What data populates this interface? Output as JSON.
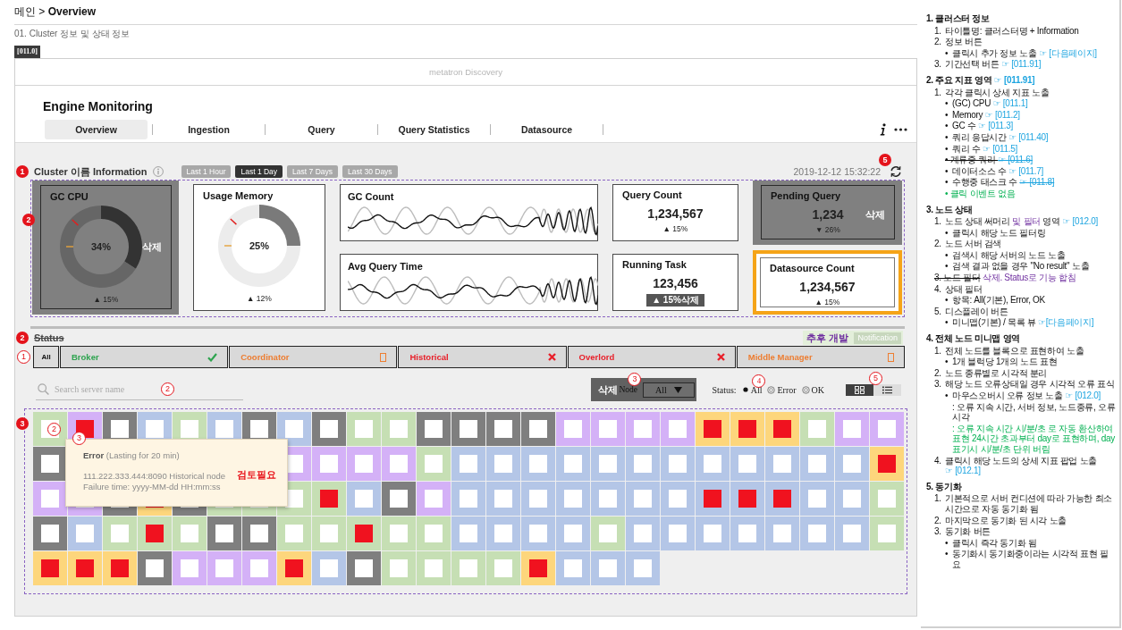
{
  "breadcrumb": "메인 > **Overview**",
  "subtitle": "01. Cluster 정보 및 상태 정보",
  "screen_tag": "[011.0]",
  "app_bar": {
    "title": "metatron Discovery"
  },
  "header": {
    "title": "Engine Monitoring",
    "tabs": [
      {
        "label": "Overview",
        "selected": true
      },
      {
        "label": "Ingestion",
        "selected": false
      },
      {
        "label": "Query",
        "selected": false
      },
      {
        "label": "Query Statistics",
        "selected": false
      },
      {
        "label": "Datasource",
        "selected": false
      }
    ]
  },
  "cluster": {
    "badge": "1",
    "title": "Cluster 이름 Information",
    "ranges": [
      {
        "label": "Last 1 Hour",
        "selected": false
      },
      {
        "label": "Last 1 Day",
        "selected": true
      },
      {
        "label": "Last 7 Days",
        "selected": false
      },
      {
        "label": "Last 30 Days",
        "selected": false
      }
    ],
    "synced_at": "2019-12-12 15:32:22",
    "sync_badge": "5"
  },
  "metrics": {
    "badge": "2",
    "cards": [
      {
        "kind": "donut",
        "title": "GC CPU",
        "value": "34%",
        "chart_data": {
          "type": "donut",
          "values": [
            34,
            66
          ]
        },
        "change": "▲ 15%",
        "note": "삭제",
        "removed": true,
        "highlighted": false
      },
      {
        "kind": "donut",
        "title": "Usage Memory",
        "value": "25%",
        "chart_data": {
          "type": "donut",
          "values": [
            25,
            75
          ]
        },
        "change": "▲ 12%",
        "removed": false,
        "highlighted": false
      },
      {
        "kind": "trend",
        "title": "GC Count",
        "removed": false,
        "highlighted": false
      },
      {
        "kind": "stat",
        "title": "Query Count",
        "value": "1,234,567",
        "change": "▲ 15%",
        "removed": false,
        "highlighted": false
      },
      {
        "kind": "stat",
        "title": "Pending Query",
        "value": "1,234",
        "change": "▼ 26%",
        "note": "삭제",
        "removed": true,
        "highlighted": false
      },
      {
        "kind": "trend",
        "title": "Avg Query Time",
        "removed": false,
        "highlighted": false
      },
      {
        "kind": "stat",
        "title": "Running Task",
        "value": "123,456",
        "change": "▲ 15%",
        "change_note": "삭제",
        "removed": false,
        "highlighted": false
      },
      {
        "kind": "stat",
        "title": "Datasource Count",
        "value": "1,234,567",
        "change": "▲ 15%",
        "removed": false,
        "highlighted": true
      }
    ]
  },
  "status": {
    "badge": "2",
    "title": "Status",
    "removed": true,
    "planned": "추후 개발",
    "notification": {
      "label": "Notification",
      "disabled": true
    },
    "filter_badge": "1",
    "all_label": "All",
    "filters": [
      {
        "label": "Broker",
        "kind": "ok",
        "color": "#2ea44f"
      },
      {
        "label": "Coordinator",
        "kind": "unknown",
        "color": "#ed7d31"
      },
      {
        "label": "Historical",
        "kind": "error",
        "color": "#e8202a"
      },
      {
        "label": "Overlord",
        "kind": "error",
        "color": "#e8202a"
      },
      {
        "label": "Middle Manager",
        "kind": "unknown",
        "color": "#ed7d31"
      }
    ]
  },
  "search": {
    "placeholder": "Search server name",
    "badge": "2"
  },
  "node_filter": {
    "removed_label": "삭제",
    "label": "Node",
    "value": "All",
    "badge": "3"
  },
  "status_filter": {
    "label": "Status:",
    "badge": "4",
    "options": [
      {
        "label": "All",
        "selected": true
      },
      {
        "label": "Error",
        "selected": false
      },
      {
        "label": "OK",
        "selected": false
      }
    ]
  },
  "view_toggle": {
    "badge": "5",
    "options": [
      {
        "kind": "grid",
        "selected": true
      },
      {
        "kind": "list",
        "selected": false
      }
    ]
  },
  "node_map": {
    "badge": "3",
    "tile_badges": [
      "2",
      "3"
    ],
    "rows": [
      {
        "tiles": [
          {
            "color": "#c6dfb4",
            "error": false
          },
          {
            "color": "#d4b1f7",
            "error": true
          },
          {
            "color": "#7f7f7f",
            "error": false
          },
          {
            "color": "#b4c6e7",
            "error": false
          },
          {
            "color": "#c6dfb4",
            "error": false
          },
          {
            "color": "#b4c6e7",
            "error": false
          },
          {
            "color": "#7f7f7f",
            "error": false
          },
          {
            "color": "#b4c6e7",
            "error": false
          },
          {
            "color": "#7f7f7f",
            "error": false
          },
          {
            "color": "#c6dfb4",
            "error": false
          },
          {
            "color": "#c6dfb4",
            "error": false
          },
          {
            "color": "#7f7f7f",
            "error": false
          },
          {
            "color": "#7f7f7f",
            "error": false
          },
          {
            "color": "#7f7f7f",
            "error": false
          },
          {
            "color": "#7f7f7f",
            "error": false
          },
          {
            "color": "#d4b1f7",
            "error": false
          },
          {
            "color": "#d4b1f7",
            "error": false
          },
          {
            "color": "#d4b1f7",
            "error": false
          },
          {
            "color": "#d4b1f7",
            "error": false
          },
          {
            "color": "#fdd67c",
            "error": true
          },
          {
            "color": "#fdd67c",
            "error": true
          },
          {
            "color": "#fdd67c",
            "error": true
          },
          {
            "color": "#c6dfb4",
            "error": false
          },
          {
            "color": "#d4b1f7",
            "error": false
          },
          {
            "color": "#d4b1f7",
            "error": false
          }
        ]
      },
      {
        "tiles": [
          {
            "color": "#7f7f7f",
            "error": false
          }
        ],
        "right_tiles": [
          {
            "color": "#d4b1f7",
            "error": false
          },
          {
            "color": "#d4b1f7",
            "error": false
          },
          {
            "color": "#d4b1f7",
            "error": false
          },
          {
            "color": "#d4b1f7",
            "error": false
          },
          {
            "color": "#c6dfb4",
            "error": false
          },
          {
            "color": "#b4c6e7",
            "error": false
          },
          {
            "color": "#b4c6e7",
            "error": false
          },
          {
            "color": "#b4c6e7",
            "error": false
          },
          {
            "color": "#b4c6e7",
            "error": false
          },
          {
            "color": "#b4c6e7",
            "error": false
          },
          {
            "color": "#b4c6e7",
            "error": false
          },
          {
            "color": "#b4c6e7",
            "error": false
          },
          {
            "color": "#b4c6e7",
            "error": false
          },
          {
            "color": "#b4c6e7",
            "error": false
          },
          {
            "color": "#b4c6e7",
            "error": false
          },
          {
            "color": "#b4c6e7",
            "error": false
          },
          {
            "color": "#b4c6e7",
            "error": false
          },
          {
            "color": "#fdd67c",
            "error": true
          }
        ]
      },
      {
        "tiles": [
          {
            "color": "#d4b1f7",
            "error": false
          },
          {
            "color": "#d4b1f7",
            "error": false
          },
          {
            "color": "#7f7f7f",
            "error": false
          },
          {
            "color": "#fdd67c",
            "error": true
          },
          {
            "color": "#7f7f7f",
            "error": false
          },
          {
            "color": "#c6dfb4",
            "error": false
          },
          {
            "color": "#c6dfb4",
            "error": false
          },
          {
            "color": "#c6dfb4",
            "error": false
          },
          {
            "color": "#c6dfb4",
            "error": true
          },
          {
            "color": "#b4c6e7",
            "error": false
          },
          {
            "color": "#7f7f7f",
            "error": false
          },
          {
            "color": "#d4b1f7",
            "error": false
          },
          {
            "color": "#b4c6e7",
            "error": false
          },
          {
            "color": "#b4c6e7",
            "error": false
          },
          {
            "color": "#b4c6e7",
            "error": false
          },
          {
            "color": "#b4c6e7",
            "error": false
          },
          {
            "color": "#b4c6e7",
            "error": false
          },
          {
            "color": "#b4c6e7",
            "error": false
          },
          {
            "color": "#b4c6e7",
            "error": false
          },
          {
            "color": "#b4c6e7",
            "error": true
          },
          {
            "color": "#b4c6e7",
            "error": true
          },
          {
            "color": "#b4c6e7",
            "error": true
          },
          {
            "color": "#b4c6e7",
            "error": false
          },
          {
            "color": "#b4c6e7",
            "error": false
          },
          {
            "color": "#c6dfb4",
            "error": false
          }
        ]
      },
      {
        "tiles": [
          {
            "color": "#7f7f7f",
            "error": false
          },
          {
            "color": "#b4c6e7",
            "error": false
          },
          {
            "color": "#c6dfb4",
            "error": false
          },
          {
            "color": "#c6dfb4",
            "error": true
          },
          {
            "color": "#c6dfb4",
            "error": false
          },
          {
            "color": "#7f7f7f",
            "error": false
          },
          {
            "color": "#7f7f7f",
            "error": false
          },
          {
            "color": "#c6dfb4",
            "error": false
          },
          {
            "color": "#c6dfb4",
            "error": false
          },
          {
            "color": "#c6dfb4",
            "error": true
          },
          {
            "color": "#c6dfb4",
            "error": false
          },
          {
            "color": "#c6dfb4",
            "error": false
          },
          {
            "color": "#b4c6e7",
            "error": false
          },
          {
            "color": "#b4c6e7",
            "error": false
          },
          {
            "color": "#b4c6e7",
            "error": false
          },
          {
            "color": "#b4c6e7",
            "error": false
          },
          {
            "color": "#c6dfb4",
            "error": false
          },
          {
            "color": "#b4c6e7",
            "error": false
          },
          {
            "color": "#b4c6e7",
            "error": false
          },
          {
            "color": "#b4c6e7",
            "error": false
          },
          {
            "color": "#b4c6e7",
            "error": false
          },
          {
            "color": "#b4c6e7",
            "error": false
          },
          {
            "color": "#b4c6e7",
            "error": false
          },
          {
            "color": "#b4c6e7",
            "error": false
          },
          {
            "color": "#c6dfb4",
            "error": false
          }
        ]
      },
      {
        "tiles": [
          {
            "color": "#fdd67c",
            "error": true
          },
          {
            "color": "#fdd67c",
            "error": true
          },
          {
            "color": "#fdd67c",
            "error": true
          },
          {
            "color": "#7f7f7f",
            "error": false
          },
          {
            "color": "#d4b1f7",
            "error": false
          },
          {
            "color": "#d4b1f7",
            "error": false
          },
          {
            "color": "#d4b1f7",
            "error": false
          },
          {
            "color": "#fdd67c",
            "error": true
          },
          {
            "color": "#b4c6e7",
            "error": false
          },
          {
            "color": "#7f7f7f",
            "error": false
          },
          {
            "color": "#c6dfb4",
            "error": false
          },
          {
            "color": "#c6dfb4",
            "error": false
          },
          {
            "color": "#c6dfb4",
            "error": false
          },
          {
            "color": "#c6dfb4",
            "error": false
          },
          {
            "color": "#fdd67c",
            "error": true
          },
          {
            "color": "#b4c6e7",
            "error": false
          },
          {
            "color": "#b4c6e7",
            "error": false
          },
          {
            "color": "#b4c6e7",
            "error": false
          }
        ]
      }
    ],
    "tooltip": {
      "title": "**Error** (Lasting for 20 min)",
      "address": "111.222.333.444:8090 Historical node",
      "failure_time": "Failure time: yyyy-MM-dd HH:mm:ss",
      "review_note": "검토필요"
    }
  },
  "spec_notes": [
    {
      "title": [
        {
          "kind": "plain",
          "text": "1. 클러스터 정보"
        }
      ],
      "items": [
        {
          "marker": "1.",
          "parts": [
            {
              "kind": "plain",
              "text": "타이틀명: 클러스터명 + Information"
            }
          ]
        },
        {
          "marker": "2.",
          "parts": [
            {
              "kind": "plain",
              "text": "정보 버튼"
            }
          ],
          "children": [
            {
              "marker": "•",
              "parts": [
                {
                  "kind": "plain",
                  "text": "클릭시 추가 정보 노출 "
                },
                {
                  "kind": "ref",
                  "text": "☞ [다음페이지]"
                }
              ]
            }
          ]
        },
        {
          "marker": "3.",
          "parts": [
            {
              "kind": "plain",
              "text": "기간선택 버튼 "
            },
            {
              "kind": "ref",
              "text": "☞ [011.91]"
            }
          ]
        }
      ]
    },
    {
      "title": [
        {
          "kind": "plain",
          "text": "2. 주요 지표 영역 "
        },
        {
          "kind": "ref",
          "text": "☞ [011.91]"
        }
      ],
      "items": [
        {
          "marker": "1.",
          "parts": [
            {
              "kind": "plain",
              "text": "각각 클릭시 상세 지표 노출"
            }
          ],
          "children": [
            {
              "marker": "•",
              "parts": [
                {
                  "kind": "plain",
                  "text": "(GC) CPU "
                },
                {
                  "kind": "ref",
                  "text": "☞ [011.1]"
                }
              ]
            },
            {
              "marker": "•",
              "parts": [
                {
                  "kind": "plain",
                  "text": "Memory "
                },
                {
                  "kind": "ref",
                  "text": "☞ [011.2]"
                }
              ]
            },
            {
              "marker": "•",
              "parts": [
                {
                  "kind": "plain",
                  "text": "GC 수 "
                },
                {
                  "kind": "ref",
                  "text": "☞ [011.3]"
                }
              ]
            },
            {
              "marker": "•",
              "parts": [
                {
                  "kind": "plain",
                  "text": "쿼리 응답시간 "
                },
                {
                  "kind": "ref",
                  "text": "☞ [011.40]"
                }
              ]
            },
            {
              "marker": "•",
              "parts": [
                {
                  "kind": "plain",
                  "text": "쿼리 수 "
                },
                {
                  "kind": "ref",
                  "text": "☞ [011.5]"
                }
              ]
            },
            {
              "parts": [
                {
                  "kind": "struck",
                  "text": "• 계류중 쿼리 "
                },
                {
                  "kind": "struck_ref",
                  "text": "☞ [011.6]"
                }
              ]
            },
            {
              "marker": "•",
              "parts": [
                {
                  "kind": "plain",
                  "text": "데이터소스 수 "
                },
                {
                  "kind": "ref",
                  "text": "☞ [011.7]"
                }
              ]
            },
            {
              "marker": "•",
              "parts": [
                {
                  "kind": "plain",
                  "text": "수행중 태스크 수 "
                },
                {
                  "kind": "struck_ref",
                  "text": "☞ [011.8]"
                }
              ]
            },
            {
              "parts": [
                {
                  "kind": "remark",
                  "text": "• 클릭 이벤트 없음"
                }
              ]
            }
          ]
        }
      ]
    },
    {
      "title": [
        {
          "kind": "plain",
          "text": "3. 노드 상태"
        }
      ],
      "items": [
        {
          "marker": "1.",
          "parts": [
            {
              "kind": "plain",
              "text": "노드 상태 써머리 "
            },
            {
              "kind": "added",
              "text": "및 필터"
            },
            {
              "kind": "plain",
              "text": " 영역 "
            },
            {
              "kind": "ref",
              "text": "☞ [012.0]"
            }
          ],
          "children": [
            {
              "marker": "•",
              "parts": [
                {
                  "kind": "plain",
                  "text": "클릭시 해당 노드 필터링"
                }
              ]
            }
          ]
        },
        {
          "marker": "2.",
          "parts": [
            {
              "kind": "plain",
              "text": "노드 서버 검색"
            }
          ],
          "children": [
            {
              "marker": "•",
              "parts": [
                {
                  "kind": "plain",
                  "text": "검색시 해당 서버의 노드 노출"
                }
              ]
            },
            {
              "marker": "•",
              "parts": [
                {
                  "kind": "plain",
                  "text": "검색 결과 없을 경우 \"No result\" 노출"
                }
              ]
            }
          ]
        },
        {
          "parts": [
            {
              "kind": "struck",
              "text": "3. 노드 필터"
            },
            {
              "kind": "added",
              "text": " 삭제. Status로 기능 합침"
            }
          ]
        },
        {
          "marker": "4.",
          "parts": [
            {
              "kind": "plain",
              "text": "상태 필터"
            }
          ],
          "children": [
            {
              "marker": "•",
              "parts": [
                {
                  "kind": "plain",
                  "text": "항목: All(기본), Error, OK"
                }
              ]
            }
          ]
        },
        {
          "marker": "5.",
          "parts": [
            {
              "kind": "plain",
              "text": "디스플레이 버튼"
            }
          ],
          "children": [
            {
              "marker": "•",
              "parts": [
                {
                  "kind": "plain",
                  "text": "미니맵(기본) / 목록 뷰 "
                },
                {
                  "kind": "ref",
                  "text": "☞[다음페이지]"
                }
              ]
            }
          ]
        }
      ]
    },
    {
      "title": [
        {
          "kind": "plain",
          "text": "4. 전체 노드 미니맵 영역"
        }
      ],
      "items": [
        {
          "marker": "1.",
          "parts": [
            {
              "kind": "plain",
              "text": "전체 노드를 블록으로 표현하여 노출"
            }
          ],
          "children": [
            {
              "marker": "•",
              "parts": [
                {
                  "kind": "plain",
                  "text": "1개 블럭당 1개의 노드 표현"
                }
              ]
            }
          ]
        },
        {
          "marker": "2.",
          "parts": [
            {
              "kind": "plain",
              "text": "노드 종류별로 시각적 분리"
            }
          ]
        },
        {
          "marker": "3.",
          "parts": [
            {
              "kind": "plain",
              "text": "해당 노드 오류상태일 경우 시각적 오류 표식"
            }
          ],
          "children": [
            {
              "marker": "•",
              "parts": [
                {
                  "kind": "plain",
                  "text": "마우스오버시 오류 정보 노출 "
                },
                {
                  "kind": "ref",
                  "text": "☞ [012.0]"
                }
              ],
              "children": [
                {
                  "parts": [
                    {
                      "kind": "plain",
                      "text": ": 오류 지속 시간, 서버 정보, 노드종류, 오류시각"
                    }
                  ]
                },
                {
                  "parts": [
                    {
                      "kind": "remark",
                      "text": ": 오류 지속 시간 시/분/초 로 자동 환산하여 표현 24시간 초과부터 day로 표현하며, day표기시 시/분/초 단위 버림"
                    }
                  ]
                }
              ]
            }
          ]
        },
        {
          "marker": "4.",
          "parts": [
            {
              "kind": "plain",
              "text": "클릭시 해당 노드의 상세 지표 팝업 노출 "
            },
            {
              "kind": "ref",
              "text": "☞ [012.1]"
            }
          ]
        }
      ]
    },
    {
      "title": [
        {
          "kind": "plain",
          "text": "5. 동기화"
        }
      ],
      "items": [
        {
          "marker": "1.",
          "parts": [
            {
              "kind": "plain",
              "text": "기본적으로 서버 컨디션에 따라 가능한 최소 시간으로 자동 동기화 됨"
            }
          ]
        },
        {
          "marker": "2.",
          "parts": [
            {
              "kind": "plain",
              "text": "마지막으로 동기화 된 시각 노출"
            }
          ]
        },
        {
          "marker": "3.",
          "parts": [
            {
              "kind": "plain",
              "text": "동기화 버튼"
            }
          ],
          "children": [
            {
              "marker": "•",
              "parts": [
                {
                  "kind": "plain",
                  "text": "클릭시 즉각 동기화 됨"
                }
              ]
            },
            {
              "marker": "•",
              "parts": [
                {
                  "kind": "plain",
                  "text": "동기화시 동기화중이라는 시각적 표현 필요"
                }
              ]
            }
          ]
        }
      ]
    }
  ]
}
